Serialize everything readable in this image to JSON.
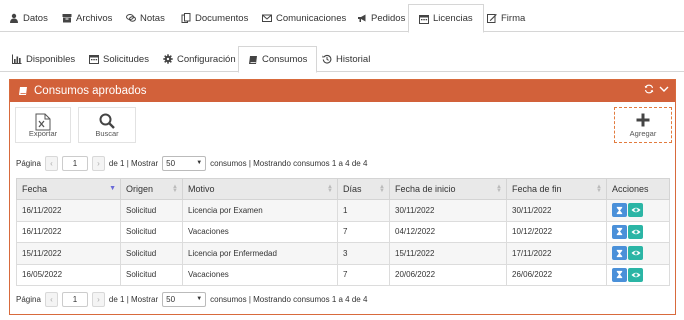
{
  "top_tabs": [
    {
      "label": "Datos",
      "icon": "person-icon"
    },
    {
      "label": "Archivos",
      "icon": "archive-icon"
    },
    {
      "label": "Notas",
      "icon": "comments-icon"
    },
    {
      "label": "Documentos",
      "icon": "documents-icon"
    },
    {
      "label": "Comunicaciones",
      "icon": "envelope-icon"
    },
    {
      "label": "Pedidos",
      "icon": "megaphone-icon"
    },
    {
      "label": "Licencias",
      "icon": "calendar-icon"
    },
    {
      "label": "Firma",
      "icon": "signature-icon"
    }
  ],
  "active_top_tab": "Licencias",
  "sub_tabs": [
    {
      "label": "Disponibles",
      "icon": "bar-chart-icon"
    },
    {
      "label": "Solicitudes",
      "icon": "calendar-icon"
    },
    {
      "label": "Configuración",
      "icon": "gear-icon"
    },
    {
      "label": "Consumos",
      "icon": "book-icon"
    },
    {
      "label": "Historial",
      "icon": "history-icon"
    }
  ],
  "active_sub_tab": "Consumos",
  "panel": {
    "title": "Consumos aprobados",
    "accent": "#d2613a"
  },
  "toolbar": {
    "export_label": "Exportar",
    "search_label": "Buscar",
    "add_label": "Agregar"
  },
  "pager": {
    "page_label": "Página",
    "page_value": "1",
    "of_label": "de 1 | Mostrar",
    "page_size": "50",
    "summary": "consumos | Mostrando consumos 1 a 4 de 4",
    "prev": "‹",
    "next": "›"
  },
  "table": {
    "headers": [
      "Fecha",
      "Origen",
      "Motivo",
      "Días",
      "Fecha de inicio",
      "Fecha de fin",
      "Acciones"
    ],
    "rows": [
      [
        "16/11/2022",
        "Solicitud",
        "Licencia por Examen",
        "1",
        "30/11/2022",
        "30/11/2022"
      ],
      [
        "16/11/2022",
        "Solicitud",
        "Vacaciones",
        "7",
        "04/12/2022",
        "10/12/2022"
      ],
      [
        "15/11/2022",
        "Solicitud",
        "Licencia por Enfermedad",
        "3",
        "15/11/2022",
        "17/11/2022"
      ],
      [
        "16/05/2022",
        "Solicitud",
        "Vacaciones",
        "7",
        "20/06/2022",
        "26/06/2022"
      ]
    ]
  }
}
